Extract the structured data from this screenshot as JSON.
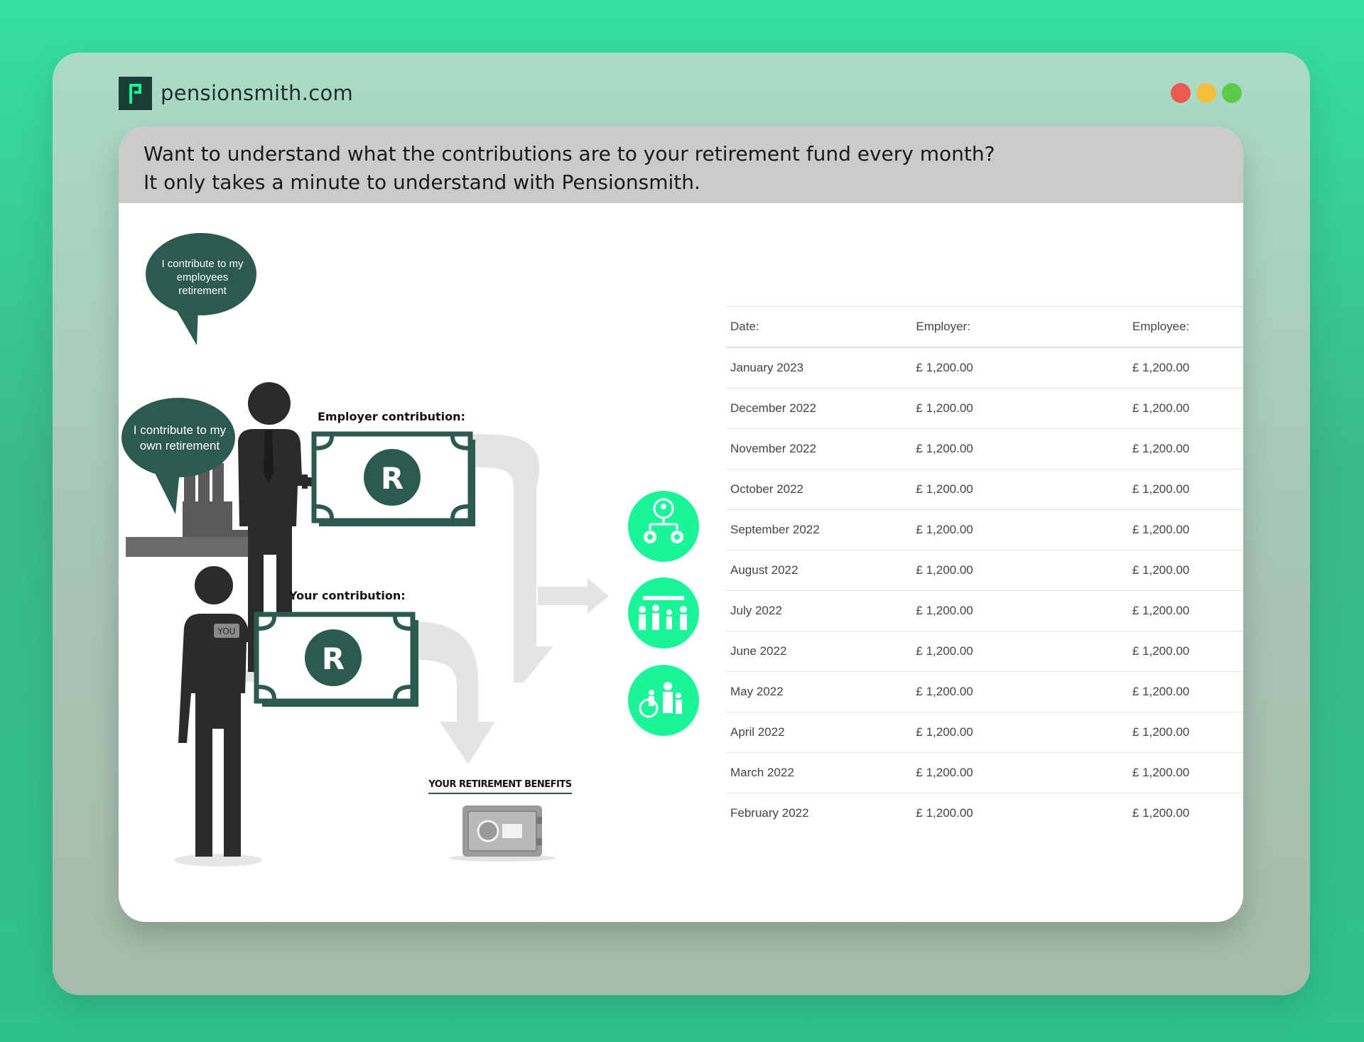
{
  "window": {
    "brand": "pensionsmith.com",
    "controls": [
      "close",
      "minimize",
      "maximize"
    ],
    "colors": {
      "close": "#ea5a4f",
      "minimize": "#f5be3d",
      "maximize": "#5ccb4a",
      "accent": "#1af59a",
      "dark_green": "#2b5a4f"
    }
  },
  "header": {
    "line1": "Want to understand what the contributions are to your retirement fund every month?",
    "line2": "It only takes a minute to understand with  Pensionsmith."
  },
  "illustration": {
    "employer_bubble": [
      "I contribute to my",
      "employees",
      "retirement"
    ],
    "employee_bubble": [
      "I contribute to my",
      "own retirement"
    ],
    "employer_label": "Employer contribution:",
    "employee_label": "Your contribution:",
    "badge": "YOU",
    "currency_symbol": "R",
    "benefits_label": "YOUR RETIREMENT BENEFITS",
    "icons": [
      "organization-icon",
      "family-group-icon",
      "family-care-icon"
    ]
  },
  "table": {
    "headers": [
      "Date:",
      "Employer:",
      "Employee:"
    ],
    "rows": [
      [
        "January 2023",
        "£ 1,200.00",
        "£ 1,200.00"
      ],
      [
        "December 2022",
        "£ 1,200.00",
        "£ 1,200.00"
      ],
      [
        "November 2022",
        "£ 1,200.00",
        "£ 1,200.00"
      ],
      [
        "October 2022",
        "£ 1,200.00",
        "£ 1,200.00"
      ],
      [
        "September 2022",
        "£ 1,200.00",
        "£ 1,200.00"
      ],
      [
        "August 2022",
        "£ 1,200.00",
        "£ 1,200.00"
      ],
      [
        "July 2022",
        "£ 1,200.00",
        "£ 1,200.00"
      ],
      [
        "June 2022",
        "£ 1,200.00",
        "£ 1,200.00"
      ],
      [
        "May 2022",
        "£ 1,200.00",
        "£ 1,200.00"
      ],
      [
        "April 2022",
        "£ 1,200.00",
        "£ 1,200.00"
      ],
      [
        "March 2022",
        "£ 1,200.00",
        "£ 1,200.00"
      ],
      [
        "February 2022",
        "£ 1,200.00",
        "£ 1,200.00"
      ]
    ]
  }
}
